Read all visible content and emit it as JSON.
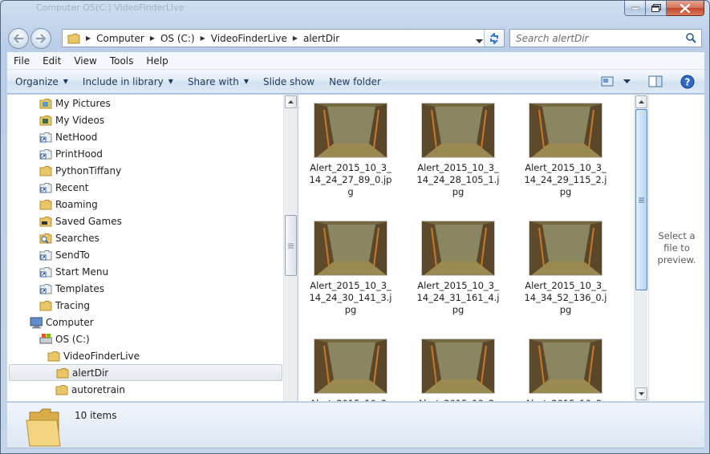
{
  "window": {
    "ghost_title": "Computer    OS(C:)    VideoFinderLive",
    "controls": {
      "minimize": "minimize",
      "maximize": "maximize",
      "close": "close"
    }
  },
  "address": {
    "crumbs": [
      "Computer",
      "OS (C:)",
      "VideoFinderLive",
      "alertDir"
    ]
  },
  "search": {
    "placeholder": "Search alertDir"
  },
  "menu": [
    "File",
    "Edit",
    "View",
    "Tools",
    "Help"
  ],
  "toolbar": {
    "organize": "Organize",
    "include_in_library": "Include in library",
    "share_with": "Share with",
    "slide_show": "Slide show",
    "new_folder": "New folder"
  },
  "nav_tree": [
    {
      "label": "My Pictures",
      "icon": "pictures-folder-icon"
    },
    {
      "label": "My Videos",
      "icon": "videos-folder-icon"
    },
    {
      "label": "NetHood",
      "icon": "shortcut-folder-icon"
    },
    {
      "label": "PrintHood",
      "icon": "shortcut-folder-icon"
    },
    {
      "label": "PythonTiffany",
      "icon": "folder-icon"
    },
    {
      "label": "Recent",
      "icon": "shortcut-folder-icon"
    },
    {
      "label": "Roaming",
      "icon": "folder-icon"
    },
    {
      "label": "Saved Games",
      "icon": "saved-games-folder-icon"
    },
    {
      "label": "Searches",
      "icon": "searches-folder-icon"
    },
    {
      "label": "SendTo",
      "icon": "shortcut-folder-icon"
    },
    {
      "label": "Start Menu",
      "icon": "shortcut-folder-icon"
    },
    {
      "label": "Templates",
      "icon": "shortcut-folder-icon"
    },
    {
      "label": "Tracing",
      "icon": "folder-icon"
    },
    {
      "label": "Computer",
      "icon": "computer-icon"
    },
    {
      "label": "OS (C:)",
      "icon": "drive-icon"
    },
    {
      "label": "VideoFinderLive",
      "icon": "folder-icon"
    },
    {
      "label": "alertDir",
      "icon": "folder-icon",
      "selected": true
    },
    {
      "label": "autoretrain",
      "icon": "folder-icon"
    }
  ],
  "files": [
    "Alert_2015_10_3_14_24_27_89_0.jpg",
    "Alert_2015_10_3_14_24_28_105_1.jpg",
    "Alert_2015_10_3_14_24_29_115_2.jpg",
    "Alert_2015_10_3_14_24_30_141_3.jpg",
    "Alert_2015_10_3_14_24_31_161_4.jpg",
    "Alert_2015_10_3_14_34_52_136_0.jpg",
    "Alert_2015_10_3_1",
    "Alert_2015_10_3_1",
    "Alert_2015_10_3_1"
  ],
  "preview_text": "Select a file to preview.",
  "status": {
    "item_count": "10 items"
  }
}
